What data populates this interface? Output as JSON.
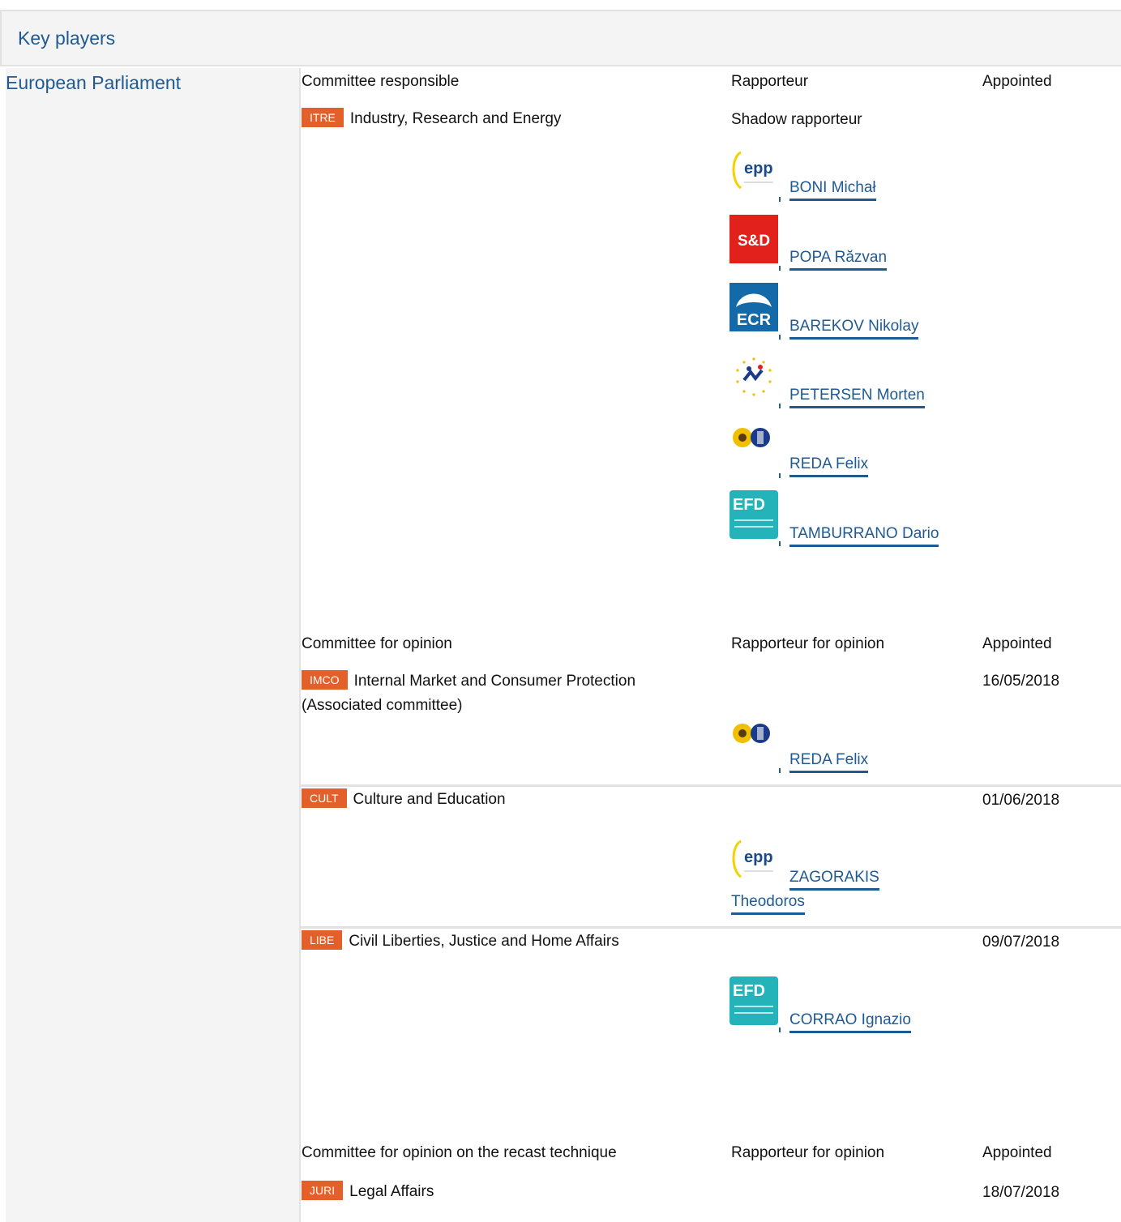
{
  "section": {
    "title": "Key players"
  },
  "institution": "European Parliament",
  "responsible": {
    "col_committee": "Committee responsible",
    "col_rapporteur": "Rapporteur",
    "col_appointed": "Appointed",
    "committee": {
      "code": "ITRE",
      "name": "Industry, Research and Energy"
    },
    "shadow_label": "Shadow rapporteur",
    "shadows": [
      {
        "group": "epp-logo",
        "name": "BONI Michał"
      },
      {
        "group": "sd-logo",
        "name": "POPA Răzvan"
      },
      {
        "group": "ecr-logo",
        "name": "BAREKOV Nikolay"
      },
      {
        "group": "alde-logo",
        "name": "PETERSEN Morten"
      },
      {
        "group": "greens-logo",
        "name": "REDA Felix"
      },
      {
        "group": "efdd-logo",
        "name": "TAMBURRANO Dario"
      }
    ]
  },
  "opinion": {
    "col_committee": "Committee for opinion",
    "col_rapporteur": "Rapporteur for opinion",
    "col_appointed": "Appointed",
    "rows": [
      {
        "code": "IMCO",
        "name": "Internal Market and Consumer Protection",
        "note": "(Associated committee)",
        "date": "16/05/2018",
        "rapporteur": "REDA Felix",
        "group": "greens-logo"
      },
      {
        "code": "CULT",
        "name": "Culture and Education",
        "date": "01/06/2018",
        "rapporteur_a": "ZAGORAKIS",
        "rapporteur_b": "Theodoros",
        "group": "epp-logo"
      },
      {
        "code": "LIBE",
        "name": "Civil Liberties, Justice and Home Affairs",
        "date": "09/07/2018",
        "rapporteur": "CORRAO Ignazio",
        "group": "efdd-logo"
      }
    ]
  },
  "recast": {
    "col_committee": "Committee for opinion on the recast technique",
    "col_rapporteur": "Rapporteur for opinion",
    "col_appointed": "Appointed",
    "committee": {
      "code": "JURI",
      "name": "Legal Affairs",
      "date": "18/07/2018"
    }
  },
  "logo_text": {
    "epp": "epp",
    "sd": "S&D",
    "ecr": "ECR",
    "efd": "EFD"
  },
  "colors": {
    "link": "#1f5a92",
    "badge": "#e4602a",
    "sd": "#e2211c",
    "ecr": "#1469a8",
    "efd": "#24b3b8"
  }
}
